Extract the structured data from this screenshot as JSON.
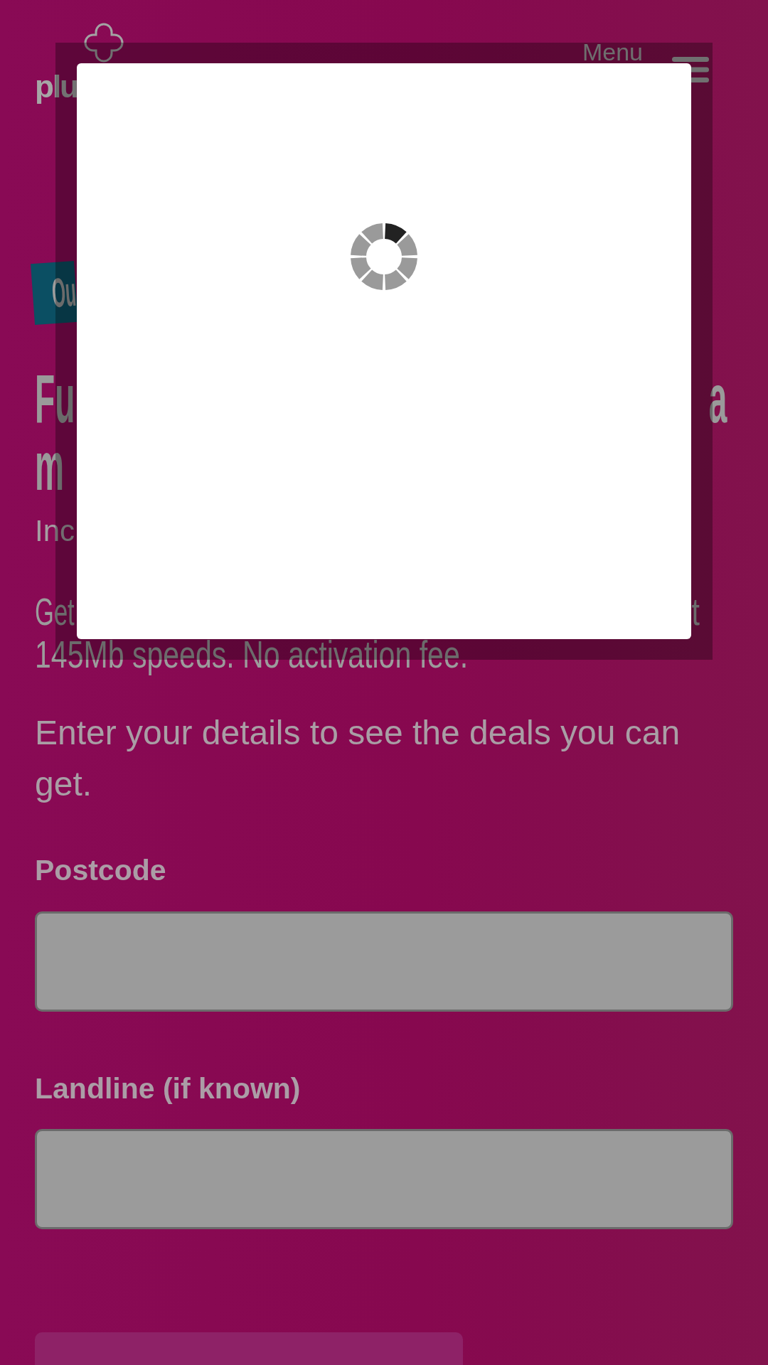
{
  "header": {
    "logo_text": "plu",
    "menu_label": "Menu"
  },
  "badge": {
    "text": "Ou"
  },
  "heading": {
    "lines": [
      [
        "Fu",
        "a"
      ],
      [
        "m"
      ]
    ]
  },
  "subheading": "Inc",
  "offer": {
    "lines": [
      [
        "Get",
        "t"
      ],
      [
        "145Mb speeds. No activation fee."
      ]
    ]
  },
  "intro": "Enter your details to see the deals you can get.",
  "form": {
    "fields": [
      {
        "label": "Postcode"
      },
      {
        "label": "Landline (if known)"
      }
    ]
  }
}
